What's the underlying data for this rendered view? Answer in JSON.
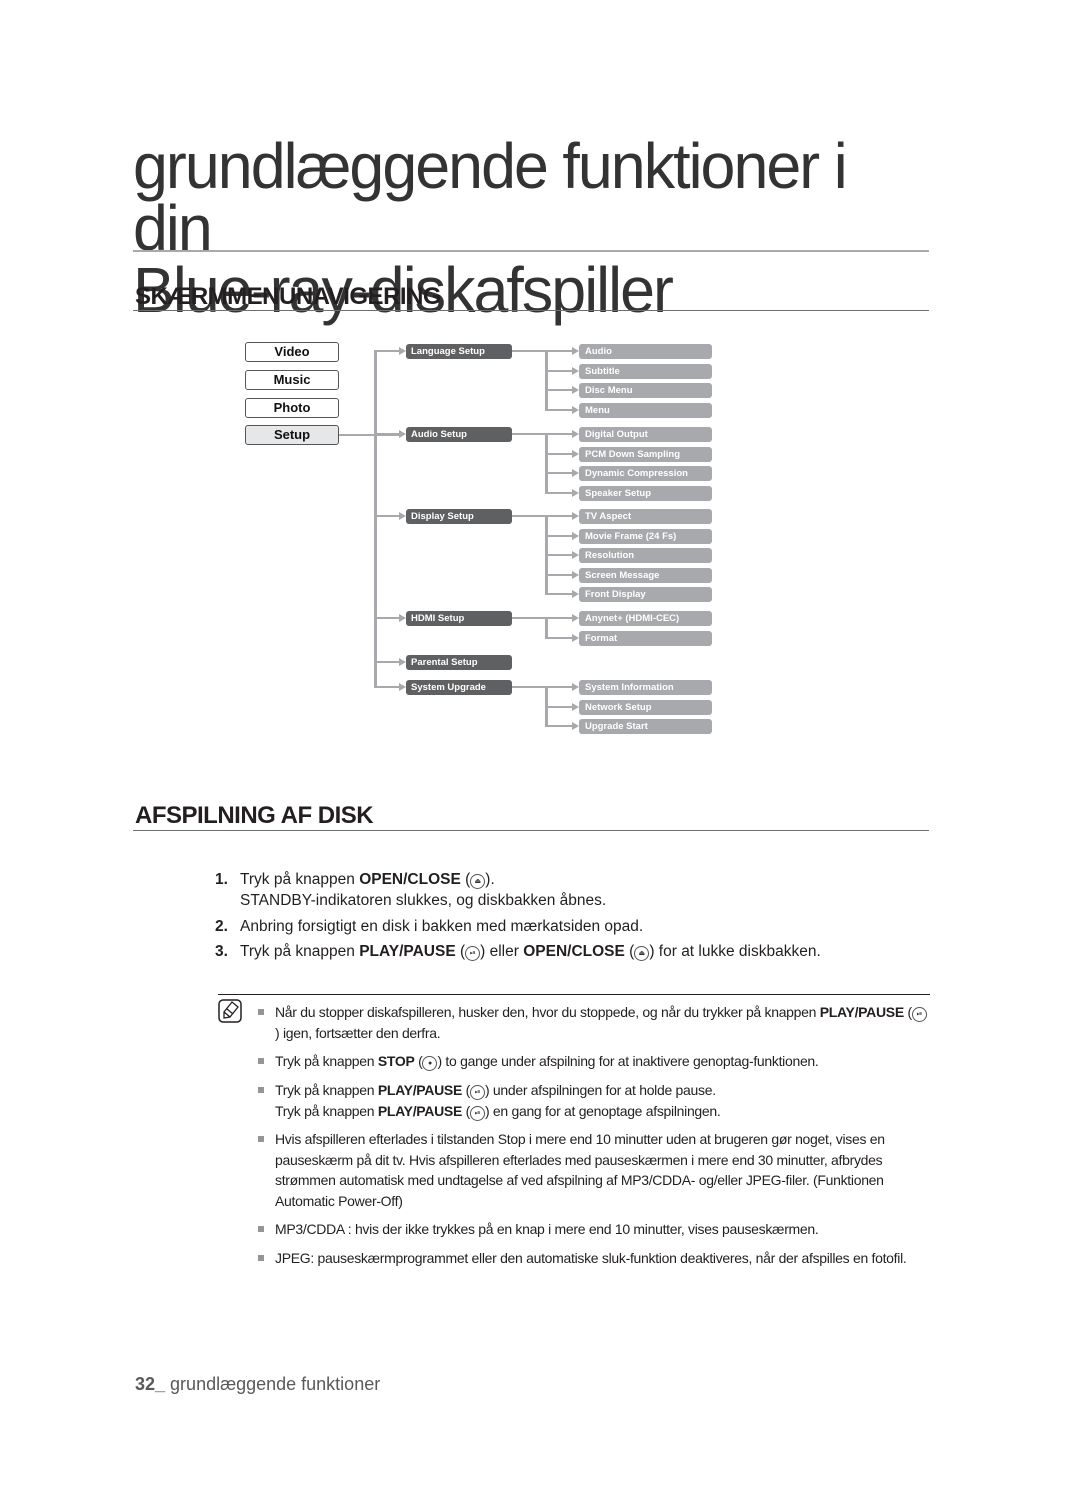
{
  "page": {
    "title_line1": "grundlæggende funktioner i din",
    "title_line2": "Blue-ray-diskafspiller"
  },
  "section1": {
    "heading": "SKÆRMMENUNAVIGERING",
    "main_menu": [
      "Video",
      "Music",
      "Photo",
      "Setup"
    ],
    "active_main": "Setup",
    "submenus": [
      {
        "label": "Language Setup",
        "children": [
          "Audio",
          "Subtitle",
          "Disc Menu",
          "Menu"
        ]
      },
      {
        "label": "Audio Setup",
        "children": [
          "Digital Output",
          "PCM Down Sampling",
          "Dynamic Compression",
          "Speaker Setup"
        ]
      },
      {
        "label": "Display Setup",
        "children": [
          "TV Aspect",
          "Movie Frame (24 Fs)",
          "Resolution",
          "Screen Message",
          "Front Display"
        ]
      },
      {
        "label": "HDMI Setup",
        "children": [
          "Anynet+ (HDMI-CEC)",
          "Format"
        ]
      },
      {
        "label": "Parental Setup",
        "children": []
      },
      {
        "label": "System Upgrade",
        "children": [
          "System Information",
          "Network Setup",
          "Upgrade Start"
        ]
      }
    ]
  },
  "section2": {
    "heading": "AFSPILNING AF DISK",
    "steps": [
      {
        "num": "1.",
        "pre": "Tryk på knappen ",
        "bold": "OPEN/CLOSE",
        "icon": "eject-icon",
        "post": ").",
        "cont": "STANDBY-indikatoren slukkes, og diskbakken åbnes."
      },
      {
        "num": "2.",
        "text": "Anbring forsigtigt en disk i bakken med mærkatsiden opad."
      },
      {
        "num": "3.",
        "pre": "Tryk på knappen ",
        "bold": "PLAY/PAUSE",
        "mid": ") eller ",
        "bold2": "OPEN/CLOSE",
        "post": ") for at lukke diskbakken."
      }
    ],
    "notes": [
      {
        "pre": "Når du stopper diskafspilleren, husker den, hvor du stoppede, og når du trykker på knappen ",
        "bold": "PLAY/PAUSE",
        "post": ") igen, fortsætter den derfra."
      },
      {
        "pre": "Tryk på knappen ",
        "bold": "STOP",
        "post": ") to gange under afspilning for at inaktivere genoptag-funktionen."
      },
      {
        "pre": "Tryk på knappen ",
        "bold": "PLAY/PAUSE",
        "post": ") under afspilningen for at holde pause.",
        "pre2": "Tryk på knappen ",
        "bold2": "PLAY/PAUSE",
        "post2": ") en gang for at genoptage afspilningen."
      },
      {
        "text": "Hvis afspilleren efterlades i tilstanden Stop i mere end 10 minutter uden at brugeren gør noget, vises en pauseskærm på dit tv. Hvis afspilleren efterlades med pauseskærmen i mere end 30 minutter, afbrydes strømmen automatisk med undtagelse af ved afspilning af MP3/CDDA- og/eller JPEG-filer. (Funktionen Automatic Power-Off)"
      },
      {
        "text": "MP3/CDDA : hvis der ikke trykkes på en knap i mere end 10 minutter, vises pauseskærmen."
      },
      {
        "text": "JPEG: pauseskærmprogrammet eller den automatiske sluk-funktion deaktiveres, når der afspilles en fotofil."
      }
    ]
  },
  "footer": {
    "page_number": "32_",
    "section": " grundlæggende funktioner"
  }
}
